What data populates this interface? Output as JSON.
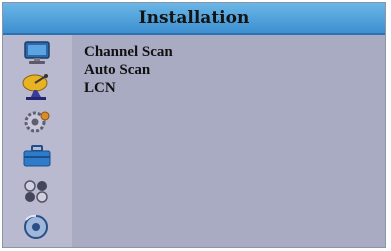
{
  "window": {
    "title": "Installation"
  },
  "sidebar": {
    "items": [
      {
        "icon": "monitor-icon",
        "selected": false
      },
      {
        "icon": "satellite-dish-icon",
        "selected": true
      },
      {
        "icon": "gear-icon",
        "selected": false
      },
      {
        "icon": "toolbox-icon",
        "selected": false
      },
      {
        "icon": "game-icon",
        "selected": false
      },
      {
        "icon": "disc-icon",
        "selected": false
      }
    ]
  },
  "menu": {
    "items": [
      {
        "label": "Channel Scan"
      },
      {
        "label": "Auto Scan"
      },
      {
        "label": "LCN"
      }
    ]
  },
  "colors": {
    "title_bar": "#3d8fd0",
    "panel": "#a9abc3",
    "sidebar": "#b9b9cf"
  }
}
